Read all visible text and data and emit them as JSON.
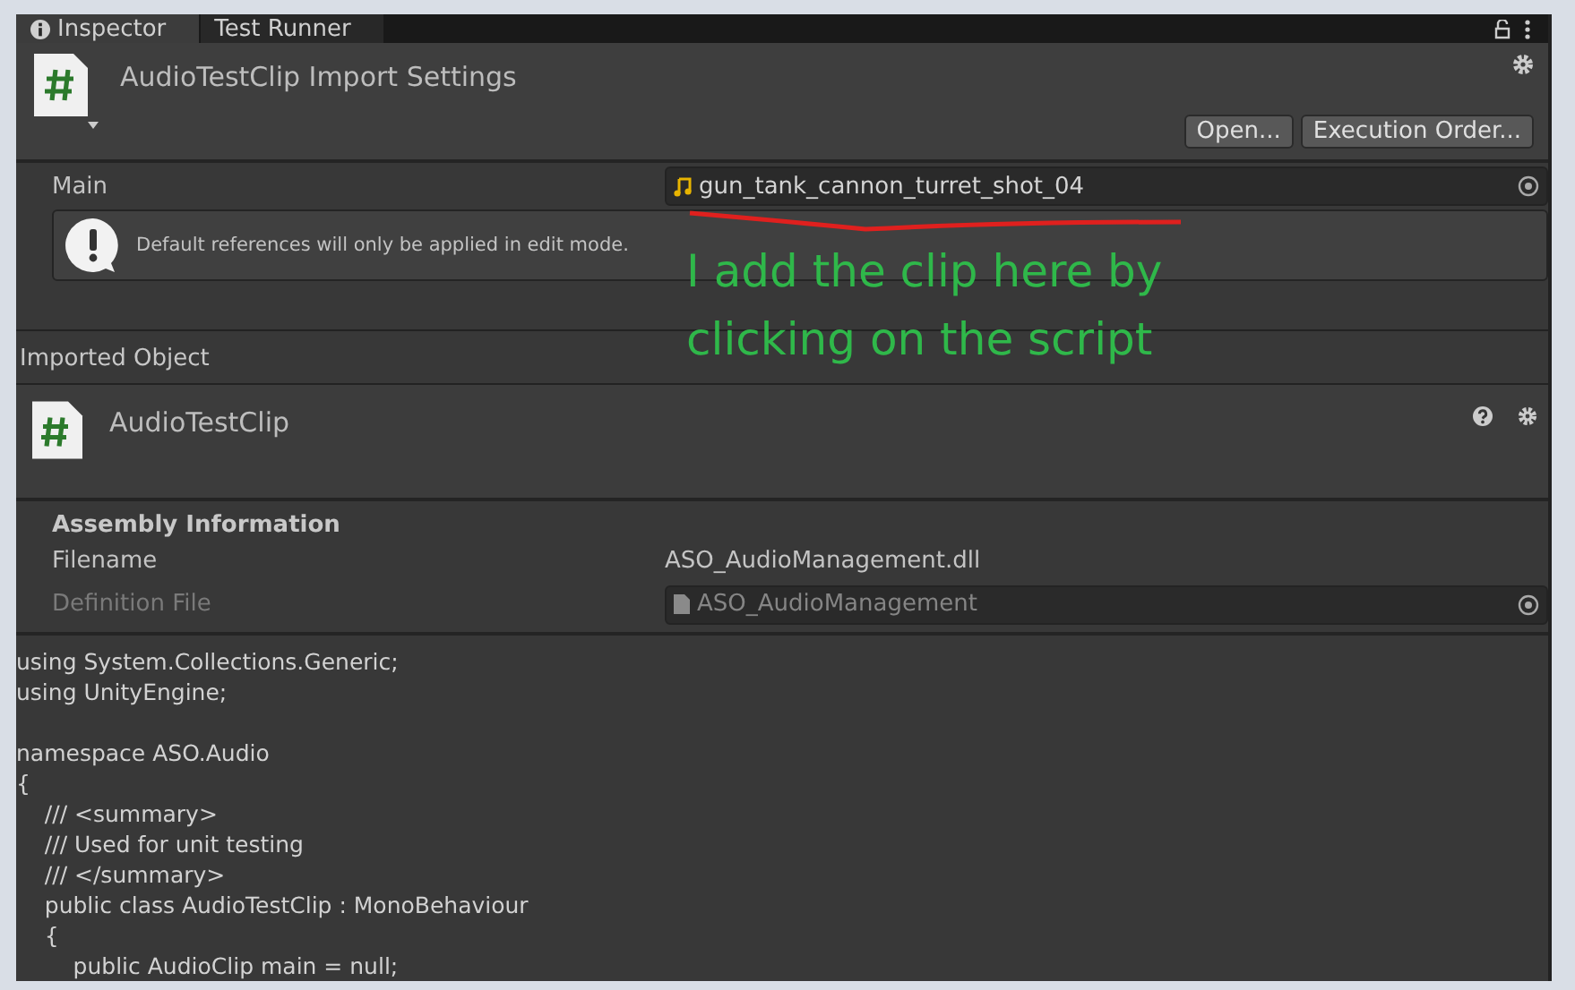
{
  "tabs": [
    {
      "label": "Inspector",
      "selected": true
    },
    {
      "label": "Test Runner",
      "selected": false
    }
  ],
  "header": {
    "title": "AudioTestClip Import Settings",
    "buttons": [
      "Open...",
      "Execution Order..."
    ]
  },
  "main_field": {
    "label": "Main",
    "value": "gun_tank_cannon_turret_shot_04"
  },
  "help_box": {
    "message": "Default references will only be applied in edit mode."
  },
  "annotation": {
    "lines": [
      "I add the clip here by",
      "clicking on the script"
    ]
  },
  "imported_object": {
    "section_title": "Imported Object",
    "name": "AudioTestClip"
  },
  "assembly": {
    "title": "Assembly Information",
    "rows": [
      {
        "label": "Filename",
        "value": "ASO_AudioManagement.dll",
        "kind": "text",
        "disabled": false
      },
      {
        "label": "Definition File",
        "value": "ASO_AudioManagement",
        "kind": "object",
        "disabled": true
      }
    ]
  },
  "code_text": "using System.Collections.Generic;\nusing UnityEngine;\n\nnamespace ASO.Audio\n{\n    /// <summary>\n    /// Used for unit testing\n    /// </summary>\n    public class AudioTestClip : MonoBehaviour\n    {\n        public AudioClip main = null;"
}
